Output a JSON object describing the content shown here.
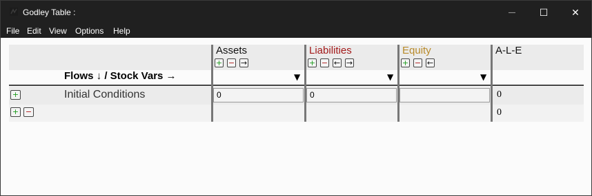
{
  "window": {
    "title": "Godley Table :",
    "controls": {
      "minimize": "—",
      "maximize": "☐",
      "close": "✕"
    }
  },
  "menu": [
    "File",
    "Edit",
    "View",
    "Options",
    "Help"
  ],
  "table": {
    "corner_label": "Flows ↓ / Stock Vars →",
    "columns": [
      {
        "name": "Assets",
        "color": "#111111",
        "buttons": [
          "+",
          "−",
          "→"
        ]
      },
      {
        "name": "Liabilities",
        "color": "#a31a1a",
        "buttons": [
          "+",
          "−",
          "←",
          "→"
        ]
      },
      {
        "name": "Equity",
        "color": "#b88a2a",
        "buttons": [
          "+",
          "−",
          "←"
        ]
      },
      {
        "name": "A-L-E",
        "color": "#111111",
        "buttons": []
      }
    ],
    "dropdown_glyph": "▼",
    "rows": [
      {
        "label": "Initial Conditions",
        "values": [
          "0",
          "0",
          ""
        ],
        "sum": "0",
        "buttons": [
          "+"
        ]
      },
      {
        "label": "",
        "values": [
          "",
          "",
          ""
        ],
        "sum": "0",
        "buttons": [
          "+",
          "−"
        ]
      }
    ]
  }
}
